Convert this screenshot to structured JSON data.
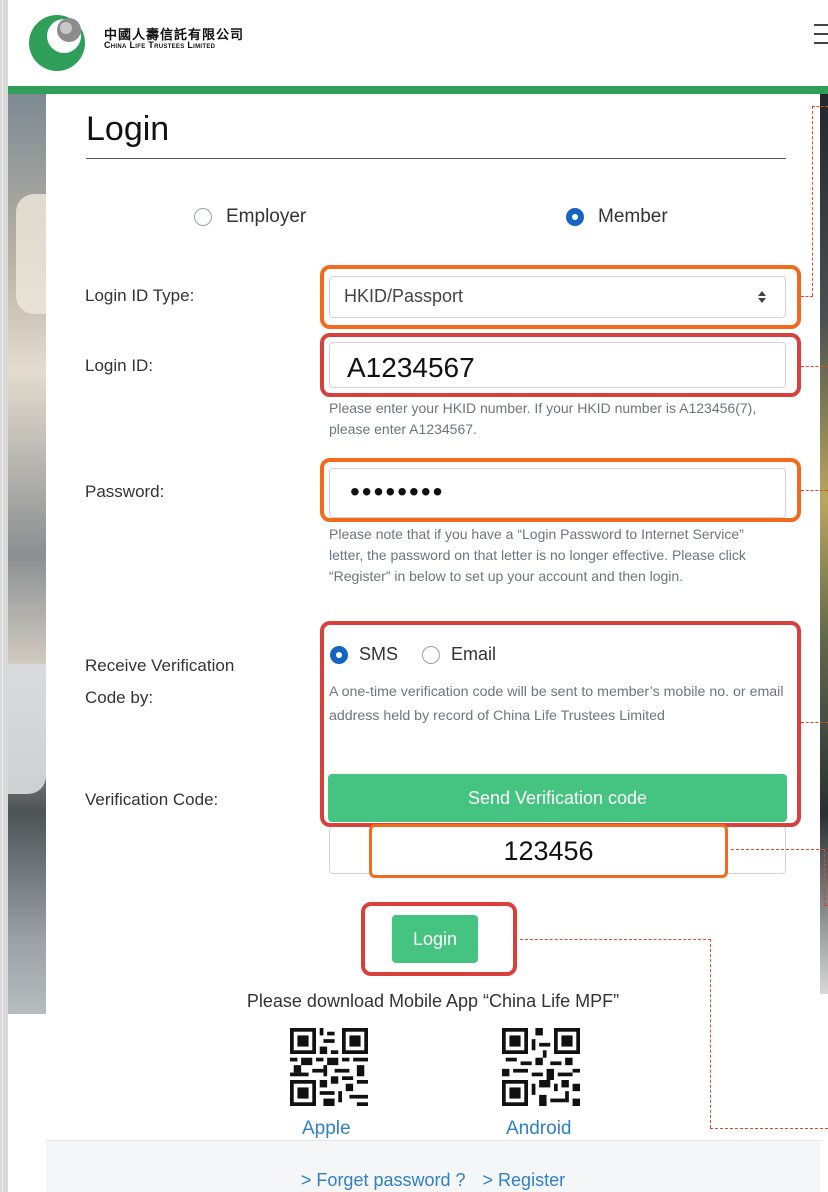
{
  "header": {
    "brand_cn": "中國人壽信託有限公司",
    "brand_en": "China Life Trustees Limited"
  },
  "login": {
    "title": "Login",
    "user_types": [
      {
        "label": "Employer",
        "checked": false
      },
      {
        "label": "Member",
        "checked": true
      }
    ],
    "login_id_type_label": "Login ID Type:",
    "login_id_type_value": "HKID/Passport",
    "login_id_label": "Login ID:",
    "login_id_value": "A1234567",
    "login_id_hint": "Please enter your HKID number. If your HKID number is A123456(7), please enter A1234567.",
    "password_label": "Password:",
    "password_value": "••••••••",
    "password_hint": "Please note that if you have a “Login Password to Internet Service” letter, the password on that letter is no longer effective. Please click “Register” in below to set up your account and then login.",
    "receive_label_line1": "Receive Verification",
    "receive_label_line2": "Code by:",
    "verify_options": [
      {
        "label": "SMS",
        "checked": true
      },
      {
        "label": "Email",
        "checked": false
      }
    ],
    "verify_hint": "A one-time verification code will be sent to member’s mobile no. or email address held by record of China Life Trustees Limited",
    "send_button": "Send Verification code",
    "verification_code_label": "Verification Code:",
    "verification_code_value": "123456",
    "login_button": "Login"
  },
  "download": {
    "text": "Please download Mobile App “China Life MPF”",
    "apple": "Apple",
    "android": "Android"
  },
  "footer": {
    "forget": "> Forget password ?",
    "register": "> Register"
  },
  "colors": {
    "brand_green": "#2e9e58",
    "button_green": "#45c481",
    "link_blue": "#2f80c7",
    "highlight_orange": "#f26a1b",
    "highlight_red": "#d8403b"
  }
}
